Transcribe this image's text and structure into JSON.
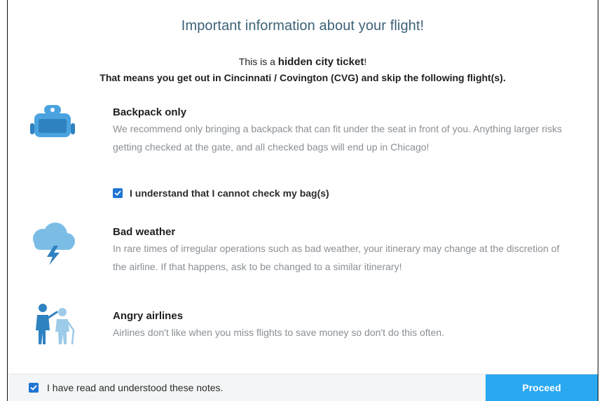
{
  "dialog": {
    "title": "Important information about your flight!",
    "intro_prefix": "This is a ",
    "intro_bold": "hidden city ticket",
    "intro_suffix": "!",
    "intro_line2": "That means you get out in Cincinnati / Covington (CVG) and skip the following flight(s)."
  },
  "sections": [
    {
      "icon": "backpack-icon",
      "title": "Backpack only",
      "body": "We recommend only bringing a backpack that can fit under the seat in front of you. Anything larger risks getting checked at the gate, and all checked bags will end up in Chicago!"
    },
    {
      "icon": "storm-cloud-icon",
      "title": "Bad weather",
      "body": "In rare times of irregular operations such as bad weather, your itinerary may change at the discretion of the airline. If that happens, ask to be changed to a similar itinerary!"
    },
    {
      "icon": "angry-people-icon",
      "title": "Angry airlines",
      "body": "Airlines don't like when you miss flights to save money so don't do this often."
    }
  ],
  "bag_checkbox": {
    "label": "I understand that I cannot check my bag(s)",
    "checked": true
  },
  "footer": {
    "notes_checkbox_label": "I have read and understood these notes.",
    "notes_checked": true,
    "proceed_label": "Proceed"
  },
  "colors": {
    "title": "#3c6177",
    "icon_blue": "#4aa3df",
    "checkbox": "#1f74d4",
    "proceed_bg": "#2aa8f2"
  }
}
